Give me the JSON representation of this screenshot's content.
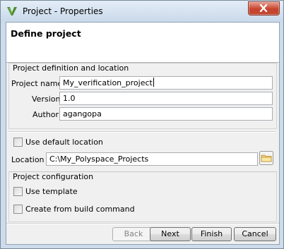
{
  "window": {
    "title": "Project - Properties",
    "app_icon": "polyspace-v-logo-icon",
    "close_icon": "close-icon"
  },
  "banner": {
    "title": "Define project"
  },
  "definition_group": {
    "title": "Project definition and location",
    "name_label": "Project name",
    "name_value": "My_verification_project",
    "version_label": "Version",
    "version_value": "1.0",
    "author_label": "Author",
    "author_value": "agangopa"
  },
  "location": {
    "use_default_label": "Use default location",
    "use_default_checked": false,
    "label": "Location",
    "value": "C:\\My_Polyspace_Projects",
    "browse_icon": "folder-icon"
  },
  "configuration_group": {
    "title": "Project configuration",
    "use_template_label": "Use template",
    "use_template_checked": false,
    "build_command_label": "Create from build command",
    "build_command_checked": false
  },
  "buttons": {
    "back": "Back",
    "next": "Next",
    "finish": "Finish",
    "cancel": "Cancel"
  }
}
